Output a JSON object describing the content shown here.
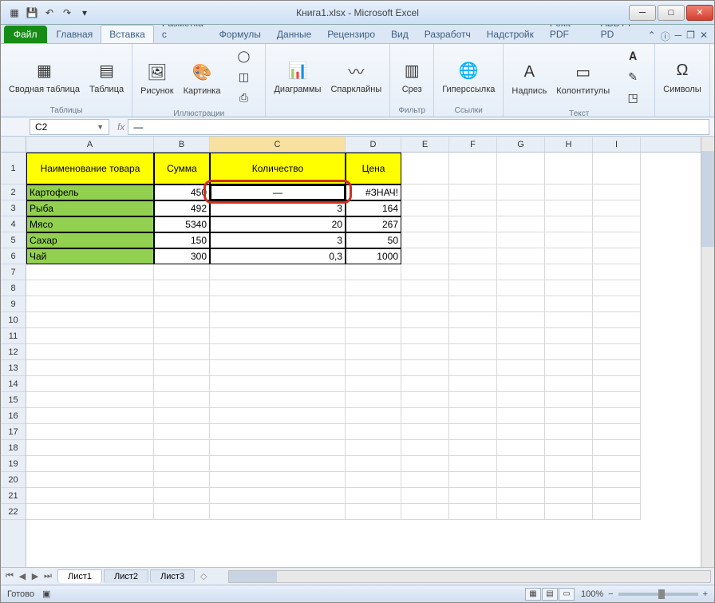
{
  "title": "Книга1.xlsx - Microsoft Excel",
  "tabs": {
    "file": "Файл",
    "list": [
      "Главная",
      "Вставка",
      "Разметка с",
      "Формулы",
      "Данные",
      "Рецензиро",
      "Вид",
      "Разработч",
      "Надстройк",
      "Foxit PDF",
      "ABBYY PD"
    ]
  },
  "ribbon": {
    "tables": {
      "pivot": "Сводная таблица",
      "table": "Таблица",
      "label": "Таблицы"
    },
    "illus": {
      "pic": "Рисунок",
      "clip": "Картинка",
      "label": "Иллюстрации"
    },
    "charts": {
      "btn": "Диаграммы",
      "spark": "Спарклайны"
    },
    "filter": {
      "slicer": "Срез",
      "label": "Фильтр"
    },
    "links": {
      "hyper": "Гиперссылка",
      "label": "Ссылки"
    },
    "text": {
      "textbox": "Надпись",
      "header": "Колонтитулы",
      "label": "Текст"
    },
    "sym": {
      "btn": "Символы"
    }
  },
  "namebox": "C2",
  "formula": "—",
  "columns": [
    "A",
    "B",
    "C",
    "D",
    "E",
    "F",
    "G",
    "H",
    "I"
  ],
  "headers": {
    "a": "Наименование товара",
    "b": "Сумма",
    "c": "Количество",
    "d": "Цена"
  },
  "rows": [
    {
      "n": "Картофель",
      "s": "450",
      "q": "—",
      "p": "#ЗНАЧ!"
    },
    {
      "n": "Рыба",
      "s": "492",
      "q": "3",
      "p": "164"
    },
    {
      "n": "Мясо",
      "s": "5340",
      "q": "20",
      "p": "267"
    },
    {
      "n": "Сахар",
      "s": "150",
      "q": "3",
      "p": "50"
    },
    {
      "n": "Чай",
      "s": "300",
      "q": "0,3",
      "p": "1000"
    }
  ],
  "sheets": [
    "Лист1",
    "Лист2",
    "Лист3"
  ],
  "status": "Готово",
  "zoom": "100%"
}
